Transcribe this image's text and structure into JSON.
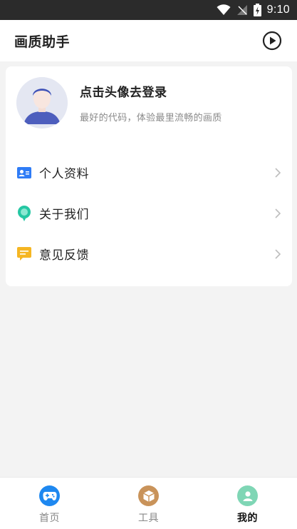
{
  "status_bar": {
    "time": "9:10"
  },
  "header": {
    "title": "画质助手",
    "play_icon": "play-circle-icon"
  },
  "profile": {
    "login_prompt": "点击头像去登录",
    "subtitle": "最好的代码，体验最里流畅的画质"
  },
  "menu": {
    "items": [
      {
        "label": "个人资料",
        "icon": "id-card-icon",
        "color": "#2f7cf6"
      },
      {
        "label": "关于我们",
        "icon": "chat-bubble-icon",
        "color": "#25c7a3"
      },
      {
        "label": "意见反馈",
        "icon": "feedback-message-icon",
        "color": "#f5b623"
      }
    ]
  },
  "tab_bar": {
    "tabs": [
      {
        "label": "首页",
        "icon": "gamepad-icon",
        "color": "#1e88f0",
        "active": false
      },
      {
        "label": "工具",
        "icon": "box-icon",
        "color": "#c9935a",
        "active": false
      },
      {
        "label": "我的",
        "icon": "user-icon",
        "color": "#7fd6b5",
        "active": true
      }
    ]
  }
}
